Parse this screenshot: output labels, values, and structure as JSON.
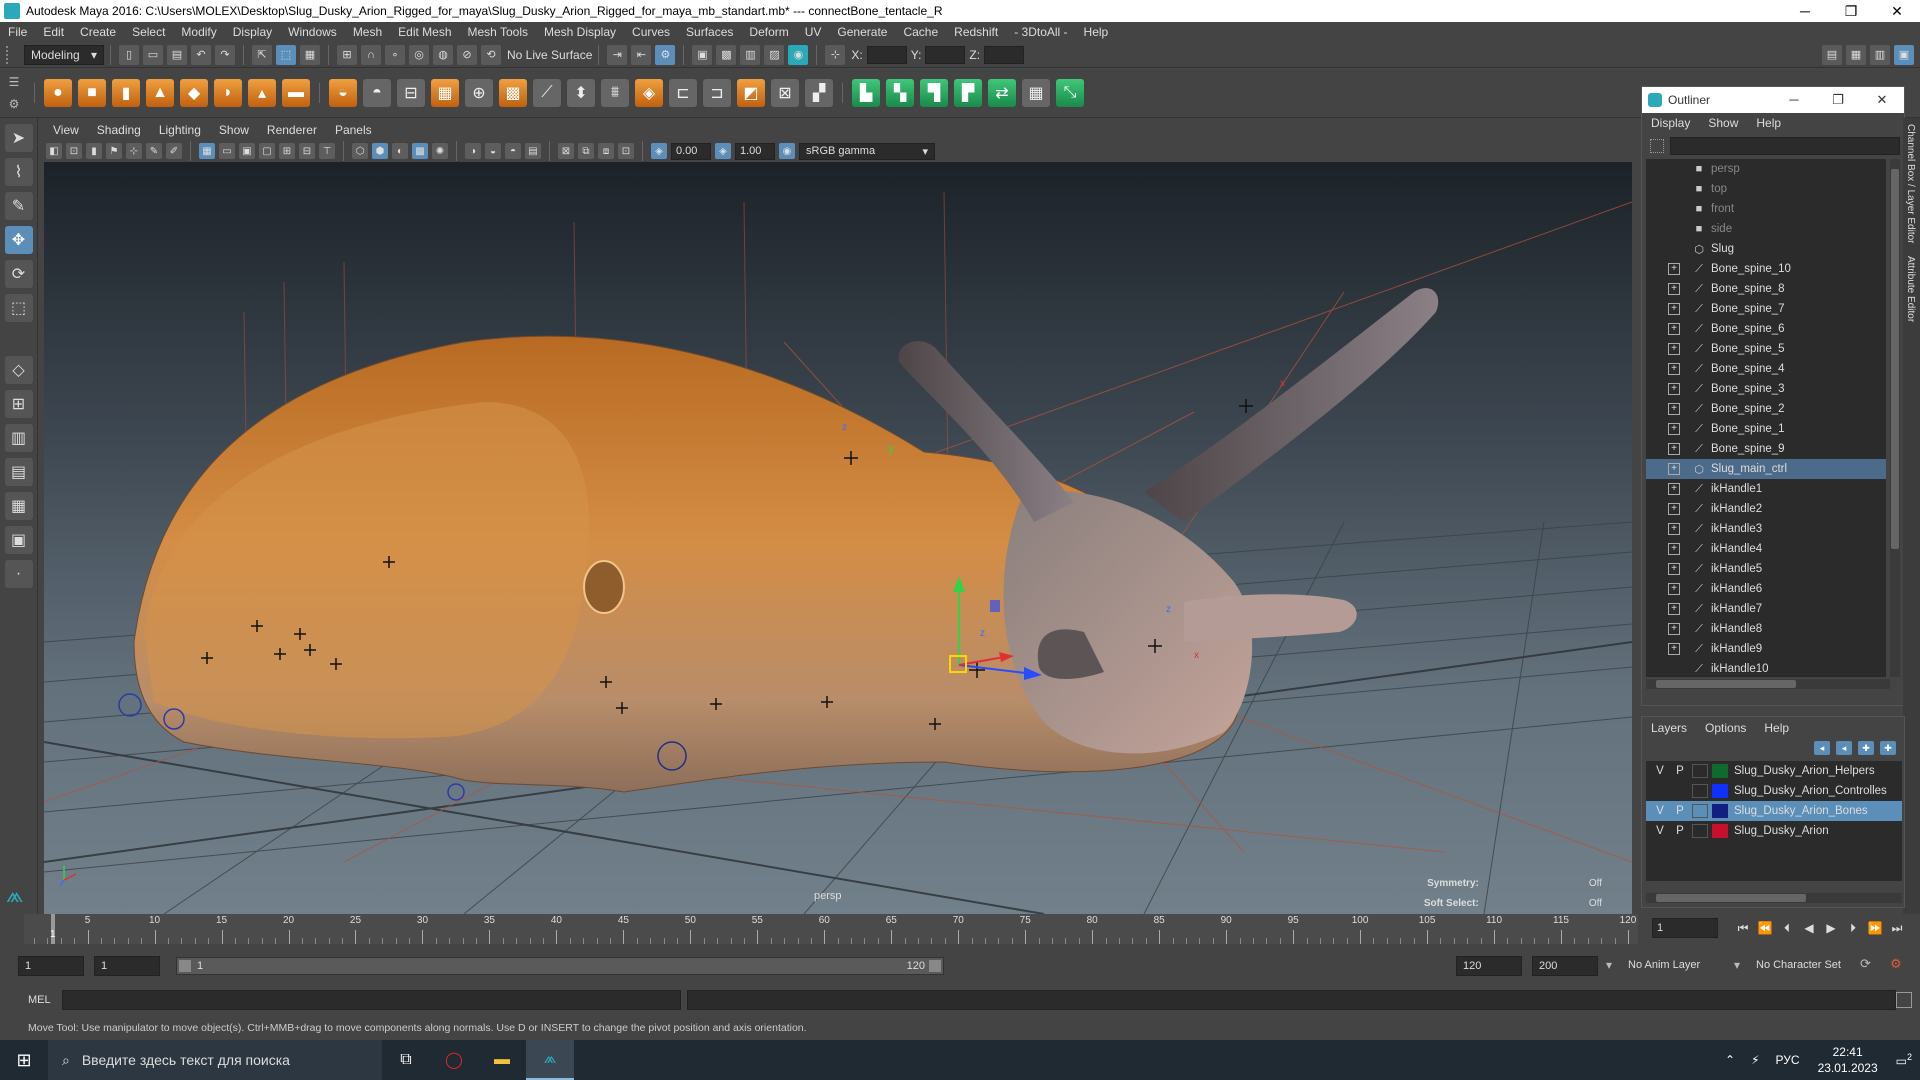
{
  "window": {
    "title": "Autodesk Maya 2016: C:\\Users\\MOLEX\\Desktop\\Slug_Dusky_Arion_Rigged_for_maya\\Slug_Dusky_Arion_Rigged_for_maya_mb_standart.mb*   ---   connectBone_tentacle_R",
    "minimize": "─",
    "maximize": "❐",
    "close": "✕"
  },
  "menubar": [
    "File",
    "Edit",
    "Create",
    "Select",
    "Modify",
    "Display",
    "Windows",
    "Mesh",
    "Edit Mesh",
    "Mesh Tools",
    "Mesh Display",
    "Curves",
    "Surfaces",
    "Deform",
    "UV",
    "Generate",
    "Cache",
    "Redshift",
    "- 3DtoAll -",
    "Help"
  ],
  "statusline": {
    "mode": "Modeling",
    "live_surface": "No Live Surface",
    "x_label": "X:",
    "y_label": "Y:",
    "z_label": "Z:"
  },
  "viewport": {
    "menu": [
      "View",
      "Shading",
      "Lighting",
      "Show",
      "Renderer",
      "Panels"
    ],
    "exposure": "0.00",
    "gamma": "1.00",
    "color_space": "sRGB gamma",
    "camera_label": "persp",
    "symmetry_label": "Symmetry:",
    "symmetry_value": "Off",
    "soft_select_label": "Soft Select:",
    "soft_select_value": "Off",
    "axis_labels": {
      "x": "x",
      "y": "y",
      "z": "z"
    }
  },
  "outliner": {
    "title": "Outliner",
    "menu": [
      "Display",
      "Show",
      "Help"
    ],
    "items": [
      {
        "name": "persp",
        "type": "camera",
        "expandable": false,
        "dim": true,
        "selected": false
      },
      {
        "name": "top",
        "type": "camera",
        "expandable": false,
        "dim": true,
        "selected": false
      },
      {
        "name": "front",
        "type": "camera",
        "expandable": false,
        "dim": true,
        "selected": false
      },
      {
        "name": "side",
        "type": "camera",
        "expandable": false,
        "dim": true,
        "selected": false
      },
      {
        "name": "Slug",
        "type": "mesh",
        "expandable": false,
        "dim": false,
        "selected": false
      },
      {
        "name": "Bone_spine_10",
        "type": "joint",
        "expandable": true,
        "dim": false,
        "selected": false
      },
      {
        "name": "Bone_spine_8",
        "type": "joint",
        "expandable": true,
        "dim": false,
        "selected": false
      },
      {
        "name": "Bone_spine_7",
        "type": "joint",
        "expandable": true,
        "dim": false,
        "selected": false
      },
      {
        "name": "Bone_spine_6",
        "type": "joint",
        "expandable": true,
        "dim": false,
        "selected": false
      },
      {
        "name": "Bone_spine_5",
        "type": "joint",
        "expandable": true,
        "dim": false,
        "selected": false
      },
      {
        "name": "Bone_spine_4",
        "type": "joint",
        "expandable": true,
        "dim": false,
        "selected": false
      },
      {
        "name": "Bone_spine_3",
        "type": "joint",
        "expandable": true,
        "dim": false,
        "selected": false
      },
      {
        "name": "Bone_spine_2",
        "type": "joint",
        "expandable": true,
        "dim": false,
        "selected": false
      },
      {
        "name": "Bone_spine_1",
        "type": "joint",
        "expandable": true,
        "dim": false,
        "selected": false
      },
      {
        "name": "Bone_spine_9",
        "type": "joint",
        "expandable": true,
        "dim": false,
        "selected": false
      },
      {
        "name": "Slug_main_ctrl",
        "type": "curve",
        "expandable": true,
        "dim": false,
        "selected": true
      },
      {
        "name": "ikHandle1",
        "type": "ik",
        "expandable": true,
        "dim": false,
        "selected": false
      },
      {
        "name": "ikHandle2",
        "type": "ik",
        "expandable": true,
        "dim": false,
        "selected": false
      },
      {
        "name": "ikHandle3",
        "type": "ik",
        "expandable": true,
        "dim": false,
        "selected": false
      },
      {
        "name": "ikHandle4",
        "type": "ik",
        "expandable": true,
        "dim": false,
        "selected": false
      },
      {
        "name": "ikHandle5",
        "type": "ik",
        "expandable": true,
        "dim": false,
        "selected": false
      },
      {
        "name": "ikHandle6",
        "type": "ik",
        "expandable": true,
        "dim": false,
        "selected": false
      },
      {
        "name": "ikHandle7",
        "type": "ik",
        "expandable": true,
        "dim": false,
        "selected": false
      },
      {
        "name": "ikHandle8",
        "type": "ik",
        "expandable": true,
        "dim": false,
        "selected": false
      },
      {
        "name": "ikHandle9",
        "type": "ik",
        "expandable": true,
        "dim": false,
        "selected": false
      },
      {
        "name": "ikHandle10",
        "type": "ik",
        "expandable": false,
        "dim": false,
        "selected": false
      }
    ]
  },
  "side_tabs": [
    "Channel Box / Layer Editor",
    "Attribute Editor"
  ],
  "layer_editor": {
    "menu": [
      "Layers",
      "Options",
      "Help"
    ],
    "layers": [
      {
        "v": "V",
        "p": "P",
        "color": "#0f6a2f",
        "name": "Slug_Dusky_Arion_Helpers",
        "selected": false
      },
      {
        "v": "",
        "p": "",
        "color": "#1030ff",
        "name": "Slug_Dusky_Arion_Controlles",
        "selected": false
      },
      {
        "v": "V",
        "p": "P",
        "color": "#101f80",
        "name": "Slug_Dusky_Arion_Bones",
        "selected": true
      },
      {
        "v": "V",
        "p": "P",
        "color": "#c8102e",
        "name": "Slug_Dusky_Arion",
        "selected": false
      }
    ]
  },
  "timeslider": {
    "ticks": [
      "5",
      "10",
      "15",
      "20",
      "25",
      "30",
      "35",
      "40",
      "45",
      "50",
      "55",
      "60",
      "65",
      "70",
      "75",
      "80",
      "85",
      "90",
      "95",
      "100",
      "105",
      "110",
      "115",
      "120"
    ],
    "current_frame": "1",
    "current_frame_field": "1"
  },
  "rangeslider": {
    "start": "1",
    "playback_start": "1",
    "range_start_label": "1",
    "range_end_label": "120",
    "playback_end": "120",
    "end": "200",
    "anim_layer": "No Anim Layer",
    "character_set": "No Character Set"
  },
  "cmdline": {
    "label": "MEL"
  },
  "helpline": "Move Tool: Use manipulator to move object(s). Ctrl+MMB+drag to move components along normals. Use D or INSERT to change the pivot position and axis orientation.",
  "taskbar": {
    "search_placeholder": "Введите здесь текст для поиска",
    "language": "РУС",
    "time": "22:41",
    "date": "23.01.2023",
    "notifications": "2"
  }
}
